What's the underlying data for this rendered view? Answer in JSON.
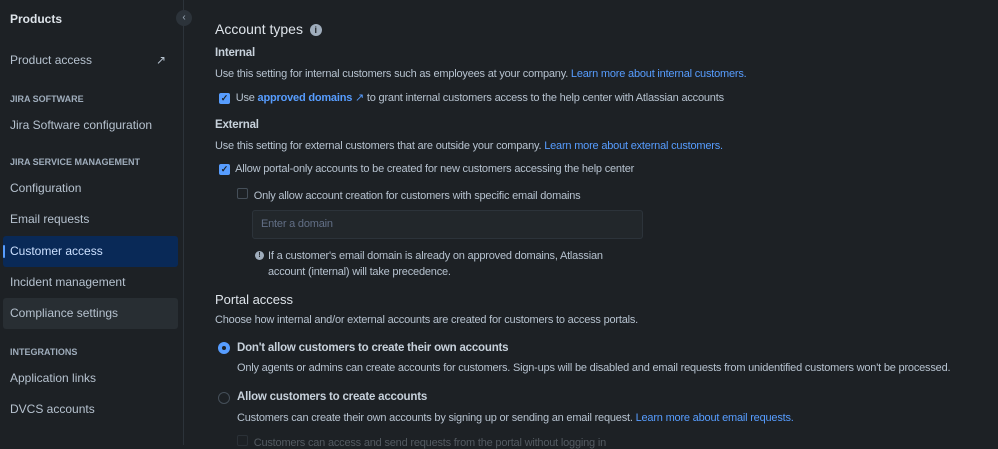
{
  "sidebar": {
    "title": "Products",
    "product_access": "Product access",
    "sections": {
      "jira_software": "JIRA SOFTWARE",
      "jsm": "JIRA SERVICE MANAGEMENT",
      "integrations": "INTEGRATIONS"
    },
    "items": {
      "jira_sw_config": "Jira Software configuration",
      "configuration": "Configuration",
      "email_requests": "Email requests",
      "customer_access": "Customer access",
      "incident_management": "Incident management",
      "compliance_settings": "Compliance settings",
      "application_links": "Application links",
      "dvcs_accounts": "DVCS accounts"
    }
  },
  "main": {
    "account_types": "Account types",
    "internal": {
      "heading": "Internal",
      "desc": "Use this setting for internal customers such as employees at your company.",
      "link": "Learn more about internal customers.",
      "cb_pre": "Use",
      "cb_link": "approved domains",
      "cb_post": "to grant internal customers access to the help center with Atlassian accounts"
    },
    "external": {
      "heading": "External",
      "desc": "Use this setting for external customers that are outside your company.",
      "link": "Learn more about external customers.",
      "cb1": "Allow portal-only accounts to be created for new customers accessing the help center",
      "cb2": "Only allow account creation for customers with specific email domains",
      "domain_placeholder": "Enter a domain",
      "note_line1": "If a customer's email domain is already on approved domains, Atlassian",
      "note_line2": "account (internal) will take precedence."
    },
    "portal": {
      "heading": "Portal access",
      "desc": "Choose how internal and/or external accounts are created for customers to access portals.",
      "opt1": "Don't allow customers to create their own accounts",
      "opt1_desc": "Only agents or admins can create accounts for customers. Sign-ups will be disabled and email requests from unidentified customers won't be processed.",
      "opt2": "Allow customers to create accounts",
      "opt2_desc": "Customers can create their own accounts by signing up or sending an email request.",
      "opt2_link": "Learn more about email requests.",
      "opt2_cb": "Customers can access and send requests from the portal without logging in"
    }
  }
}
